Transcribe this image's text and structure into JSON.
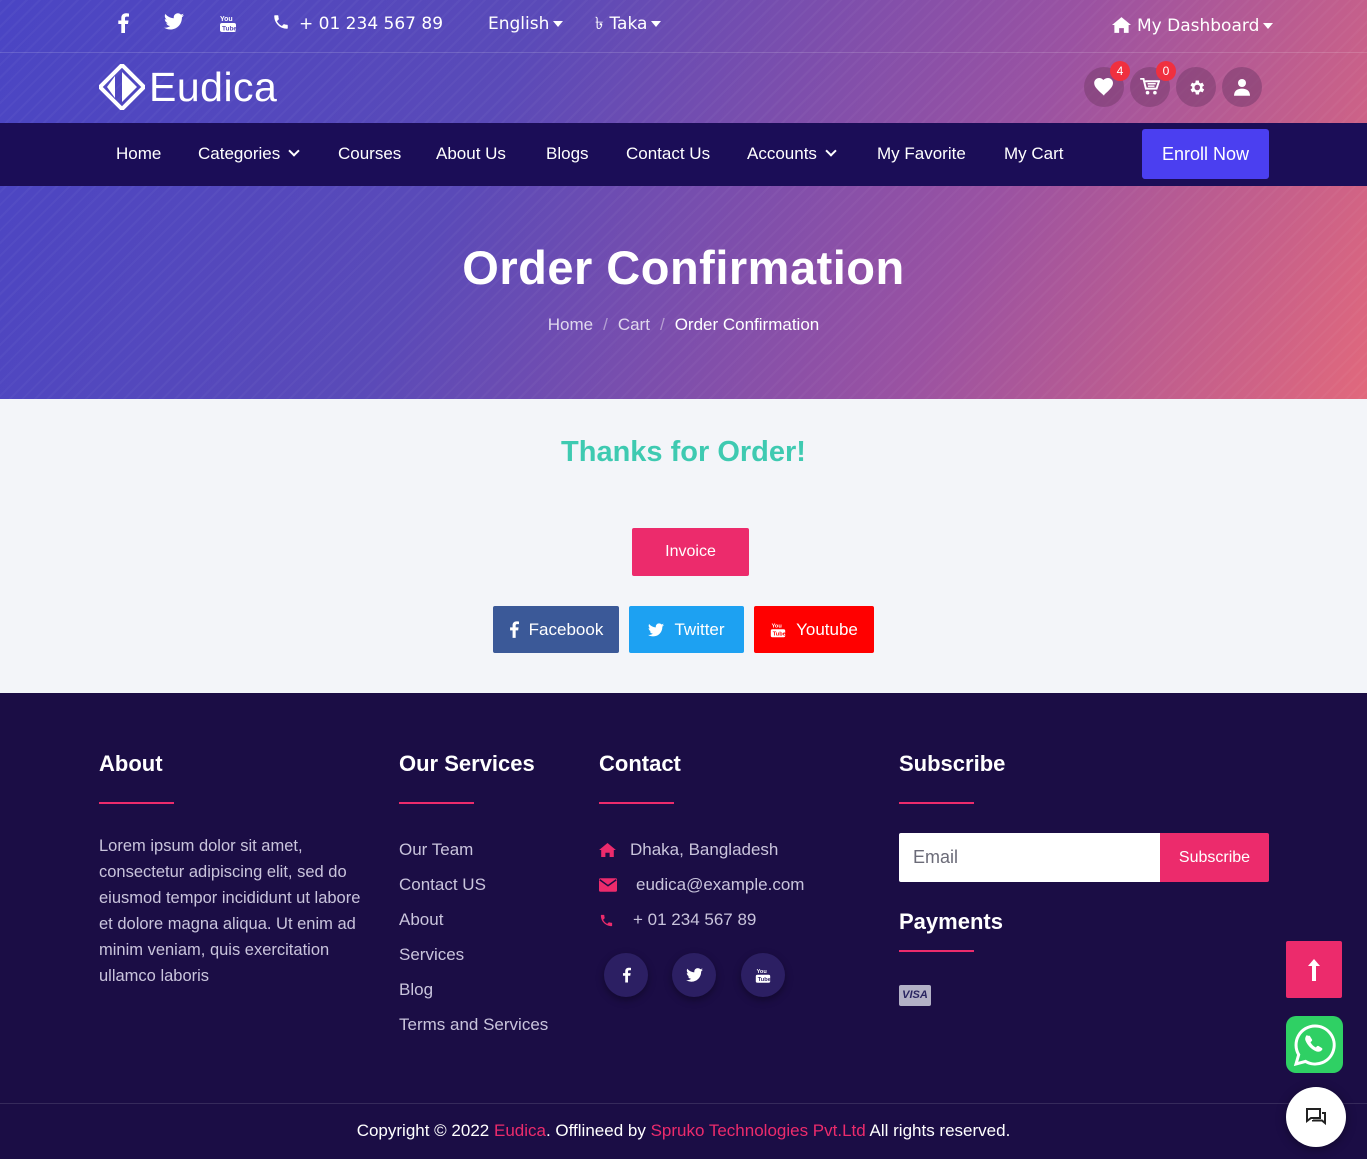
{
  "topbar": {
    "phone": "+ 01 234 567 89",
    "language": "English",
    "currency": "Taka",
    "dashboard": "My Dashboard"
  },
  "brand": {
    "name": "Eudica"
  },
  "header_icons": {
    "favorites_count": "4",
    "cart_count": "0"
  },
  "nav": {
    "items": [
      "Home",
      "Categories",
      "Courses",
      "About Us",
      "Blogs",
      "Contact Us",
      "Accounts",
      "My Favorite",
      "My Cart"
    ],
    "cta": "Enroll Now"
  },
  "banner": {
    "title": "Order Confirmation",
    "breadcrumb": [
      "Home",
      "Cart",
      "Order Confirmation"
    ]
  },
  "content": {
    "thanks": "Thanks for Order!",
    "invoice": "Invoice",
    "share": [
      {
        "label": "Facebook",
        "color": "#3b5998"
      },
      {
        "label": "Twitter",
        "color": "#1da1f2"
      },
      {
        "label": "Youtube",
        "color": "#ff0000"
      }
    ]
  },
  "footer": {
    "about": {
      "heading": "About",
      "text": "Lorem ipsum dolor sit amet, consectetur adipiscing elit, sed do eiusmod tempor incididunt ut labore et dolore magna aliqua. Ut enim ad minim veniam, quis exercitation ullamco laboris"
    },
    "services": {
      "heading": "Our Services",
      "links": [
        "Our Team",
        "Contact US",
        "About",
        "Services",
        "Blog",
        "Terms and Services"
      ]
    },
    "contact": {
      "heading": "Contact",
      "address": "Dhaka, Bangladesh",
      "email": "eudica@example.com",
      "phone": "+ 01 234 567 89"
    },
    "subscribe": {
      "heading": "Subscribe",
      "placeholder": "Email",
      "button": "Subscribe"
    },
    "payments": {
      "heading": "Payments",
      "card": "VISA"
    },
    "copyright": {
      "prefix": "Copyright © 2022",
      "brand": "Eudica",
      "middle": ". Offlineed by",
      "company": "Spruko Technologies Pvt.Ltd",
      "suffix": "All rights reserved."
    }
  },
  "colors": {
    "accent": "#ec2b6c",
    "nav_bg": "#1b0d57",
    "footer_bg": "#1b0d45",
    "cta": "#4b3ff0",
    "success": "#3ecab1"
  }
}
